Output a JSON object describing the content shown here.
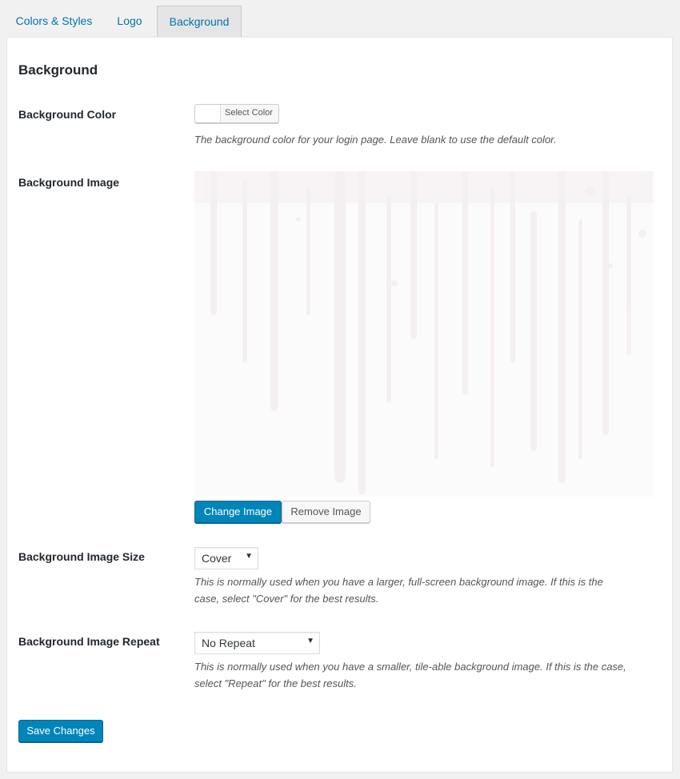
{
  "tabs": [
    {
      "label": "Colors & Styles"
    },
    {
      "label": "Logo"
    },
    {
      "label": "Background",
      "active": true
    }
  ],
  "section_title": "Background",
  "background_color": {
    "label": "Background Color",
    "button_label": "Select Color",
    "value": "",
    "description": "The background color for your login page. Leave blank to use the default color."
  },
  "background_image": {
    "label": "Background Image",
    "change_label": "Change Image",
    "remove_label": "Remove Image"
  },
  "background_image_size": {
    "label": "Background Image Size",
    "selected": "Cover",
    "description_line1": "This is normally used when you have a larger, full-screen background image. If this is the",
    "description_line2": "case, select \"Cover\" for the best results."
  },
  "background_image_repeat": {
    "label": "Background Image Repeat",
    "selected": "No Repeat",
    "description_line1": "This is normally used when you have a smaller, tile-able background image. If this is the case,",
    "description_line2": "select \"Repeat\" for the best results."
  },
  "save_label": "Save Changes",
  "colors": {
    "accent": "#0085ba",
    "link": "#0073aa",
    "page_bg": "#f1f1f1"
  }
}
